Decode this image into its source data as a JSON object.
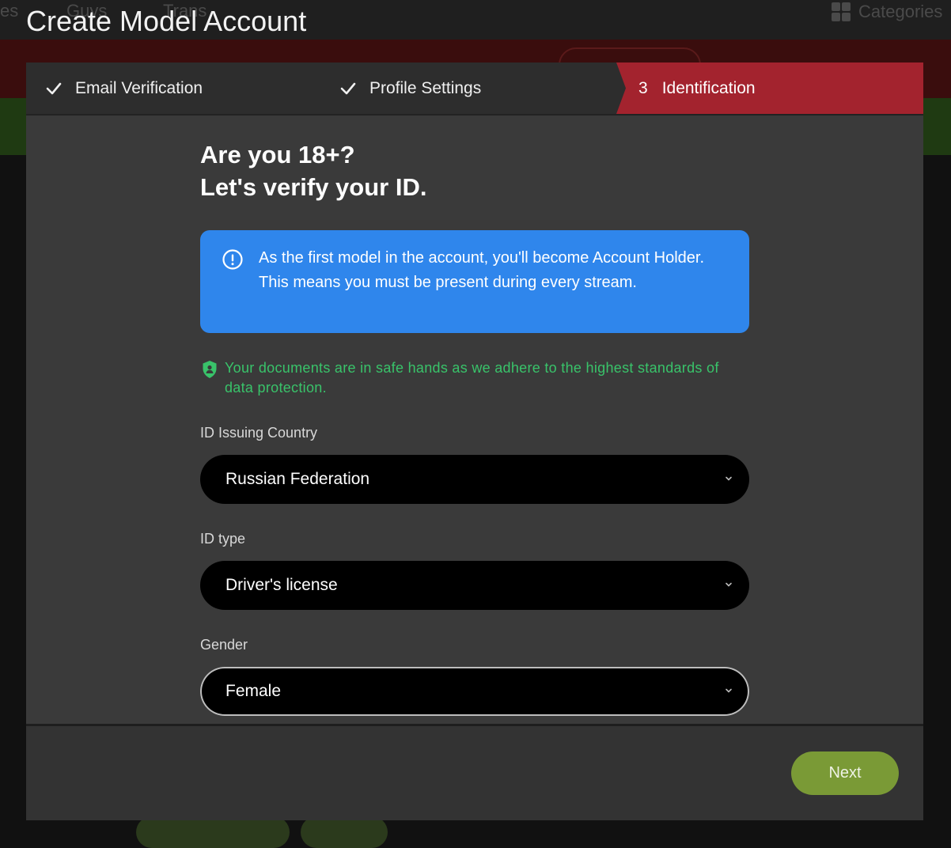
{
  "page": {
    "title": "Create Model Account"
  },
  "background_nav": {
    "item_1": "es",
    "item_2": "Guys",
    "item_3": "Trans",
    "categories": "Categories"
  },
  "stepper": {
    "steps": [
      {
        "label": "Email Verification",
        "state": "done"
      },
      {
        "label": "Profile Settings",
        "state": "done"
      },
      {
        "number": "3",
        "label": "Identification",
        "state": "active"
      }
    ],
    "active_color": "#a3232e"
  },
  "heading": {
    "line1": "Are you 18+?",
    "line2": "Let's verify your ID."
  },
  "info_box": {
    "text": "As the first model in the account, you'll become Account Holder. This means you must be present during every stream.",
    "icon": "info-circle-icon",
    "color": "#2f86ec"
  },
  "security_note": {
    "text": "Your documents are in safe hands as we adhere to the highest standards of data protection.",
    "icon": "shield-icon"
  },
  "fields": {
    "country": {
      "label": "ID Issuing Country",
      "value": "Russian Federation"
    },
    "id_type": {
      "label": "ID type",
      "value": "Driver's license"
    },
    "gender": {
      "label": "Gender",
      "value": "Female"
    }
  },
  "footer": {
    "next_label": "Next",
    "next_color": "#7a9a36"
  }
}
